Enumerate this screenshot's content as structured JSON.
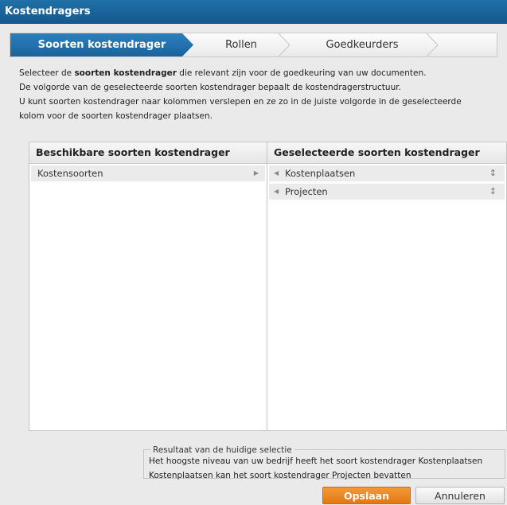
{
  "window": {
    "title": "Kostendragers"
  },
  "wizard": {
    "steps": [
      {
        "label": "Soorten kostendrager",
        "active": true
      },
      {
        "label": "Rollen",
        "active": false
      },
      {
        "label": "Goedkeurders",
        "active": false
      }
    ]
  },
  "intro": {
    "line1_pre": "Selecteer de ",
    "line1_bold": "soorten kostendrager",
    "line1_post": " die relevant zijn voor de goedkeuring van uw documenten.",
    "line2": "De volgorde van de geselecteerde soorten kostendrager bepaalt de kostendragerstructuur.",
    "line3": "U kunt soorten kostendrager naar kolommen verslepen en ze zo in de juiste volgorde in de geselecteerde",
    "line4": "kolom voor de soorten kostendrager plaatsen."
  },
  "available": {
    "header": "Beschikbare soorten kostendrager",
    "items": [
      {
        "label": "Kostensoorten",
        "icon": "arrow-right-icon"
      }
    ]
  },
  "selected": {
    "header": "Geselecteerde soorten kostendrager",
    "items": [
      {
        "label": "Kostenplaatsen",
        "icon": "arrow-left-icon",
        "handle": "↕"
      },
      {
        "label": "Projecten",
        "icon": "arrow-left-icon",
        "handle": "↕"
      }
    ]
  },
  "result": {
    "legend": "Resultaat van de huidige selectie",
    "line1": "Het hoogste niveau van uw bedrijf heeft het soort kostendrager Kostenplaatsen",
    "line2": "Kostenplaatsen kan het soort kostendrager Projecten bevatten"
  },
  "buttons": {
    "save": "Opslaan",
    "cancel": "Annuleren"
  },
  "colors": {
    "title_bar": "#1a639d",
    "active_step": "#1f6fa9",
    "save_button": "#e8841f"
  }
}
